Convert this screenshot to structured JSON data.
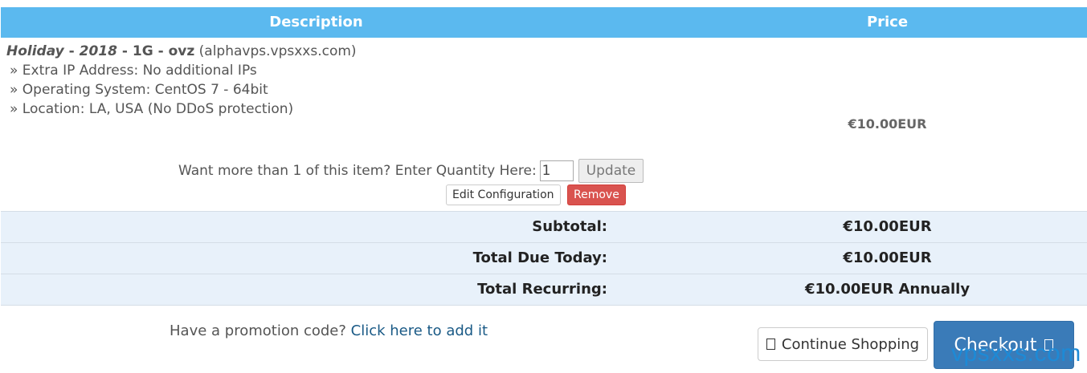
{
  "table": {
    "header": {
      "description": "Description",
      "price": "Price"
    }
  },
  "item": {
    "name": "Holiday",
    "sep1": " - ",
    "year": "2018",
    "sep2": " - ",
    "plan": "1G - ovz",
    "domain": " (alphavps.vpsxxs.com)",
    "details": [
      "» Extra IP Address: No additional IPs",
      "» Operating System: CentOS 7 - 64bit",
      "» Location: LA, USA (No DDoS protection)"
    ],
    "price": "€10.00EUR",
    "quantity_prompt": "Want more than 1 of this item? Enter Quantity Here:",
    "quantity_value": "1",
    "update_label": "Update",
    "edit_label": "Edit Configuration",
    "remove_label": "Remove"
  },
  "totals": [
    {
      "label": "Subtotal:",
      "value": "€10.00EUR"
    },
    {
      "label": "Total Due Today:",
      "value": "€10.00EUR"
    },
    {
      "label": "Total Recurring:",
      "value": "€10.00EUR Annually"
    }
  ],
  "promo": {
    "text": "Have a promotion code? ",
    "link": "Click here to add it"
  },
  "actions": {
    "continue_label": "Continue Shopping",
    "checkout_label": "Checkout"
  },
  "watermark": "vpsxxs.com",
  "colors": {
    "header_bg": "#5bb9ef",
    "totals_bg": "#e8f1fa",
    "remove_bg": "#d9534f",
    "checkout_bg": "#3a7bb8",
    "link": "#1a5a86"
  }
}
